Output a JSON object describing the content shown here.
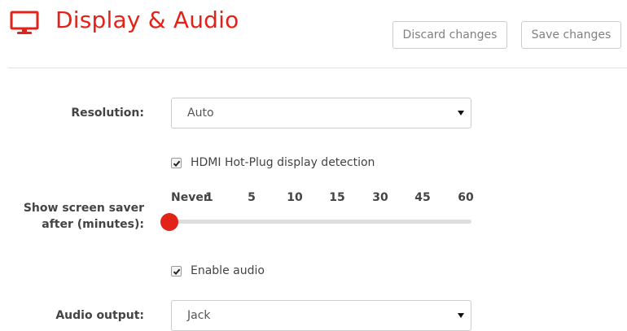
{
  "header": {
    "title": "Display & Audio",
    "icon": "monitor-icon",
    "accent_color": "#e2231a",
    "discard_label": "Discard changes",
    "save_label": "Save changes"
  },
  "resolution": {
    "label": "Resolution:",
    "value": "Auto"
  },
  "hdmi_hotplug": {
    "label": "HDMI Hot-Plug display detection",
    "checked": true
  },
  "screen_saver": {
    "label_line1": "Show screen saver",
    "label_line2": "after (minutes):",
    "ticks": [
      "Never",
      "1",
      "5",
      "10",
      "15",
      "30",
      "45",
      "60"
    ],
    "selected": "Never"
  },
  "enable_audio": {
    "label": "Enable audio",
    "checked": true
  },
  "audio_output": {
    "label": "Audio output:",
    "value": "Jack"
  }
}
